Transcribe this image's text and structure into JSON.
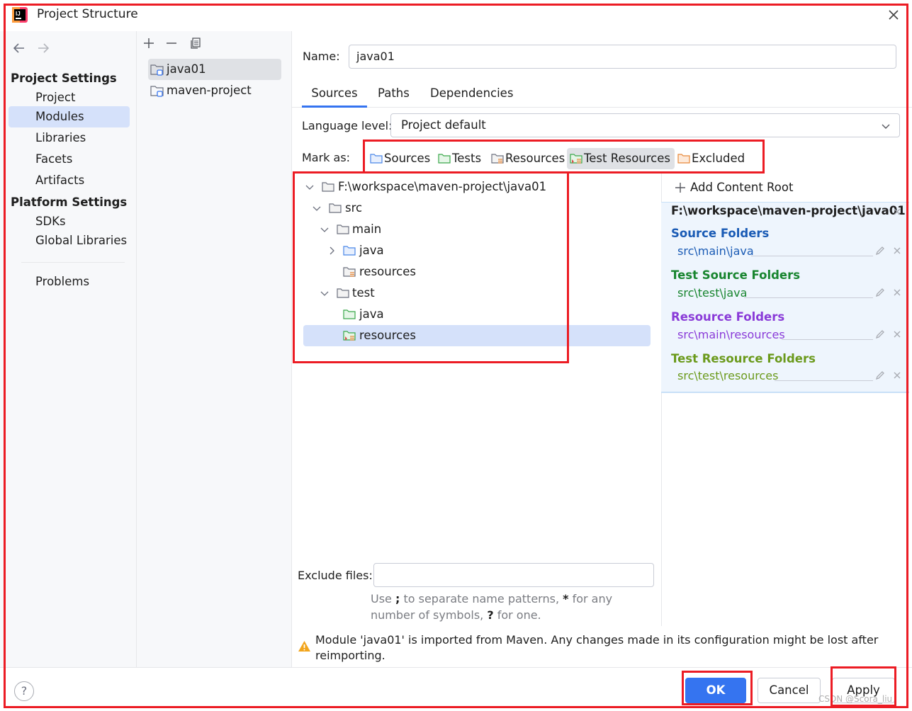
{
  "window": {
    "title": "Project Structure"
  },
  "nav": {
    "project_settings": "Project Settings",
    "project_items": [
      "Project",
      "Modules",
      "Libraries",
      "Facets",
      "Artifacts"
    ],
    "platform_settings": "Platform Settings",
    "platform_items": [
      "SDKs",
      "Global Libraries"
    ],
    "problems": "Problems",
    "selected": "Modules"
  },
  "modules": {
    "items": [
      "java01",
      "maven-project"
    ],
    "selected": "java01"
  },
  "module": {
    "name_label": "Name:",
    "name_value": "java01",
    "tabs": [
      "Sources",
      "Paths",
      "Dependencies"
    ],
    "active_tab": "Sources",
    "language_level_label": "Language level:",
    "language_level_value": "Project default",
    "mark_as_label": "Mark as:",
    "mark_buttons": [
      "Sources",
      "Tests",
      "Resources",
      "Test Resources",
      "Excluded"
    ],
    "pressed_mark": "Test Resources"
  },
  "tree": {
    "root": "F:\\workspace\\maven-project\\java01",
    "src": "src",
    "main": "main",
    "main_java": "java",
    "main_resources": "resources",
    "test": "test",
    "test_java": "java",
    "test_resources": "resources"
  },
  "content_root": {
    "add_label": "Add Content Root",
    "path": "F:\\workspace\\maven-project\\java01",
    "groups": [
      {
        "title": "Source Folders",
        "path": "src\\main\\java",
        "color": "#1a5bb5"
      },
      {
        "title": "Test Source Folders",
        "path": "src\\test\\java",
        "color": "#18852f"
      },
      {
        "title": "Resource Folders",
        "path": "src\\main\\resources",
        "color": "#8a3bd8"
      },
      {
        "title": "Test Resource Folders",
        "path": "src\\test\\resources",
        "color": "#6b9a1c"
      }
    ]
  },
  "exclude": {
    "label": "Exclude files:",
    "value": "",
    "hint_part1": "Use ",
    "hint_sep": ";",
    "hint_part2": " to separate name patterns, ",
    "hint_star": "*",
    "hint_part3": " for any number of symbols, ",
    "hint_q": "?",
    "hint_part4": " for one."
  },
  "warning": "Module 'java01' is imported from Maven. Any changes made in its configuration might be lost after reimporting.",
  "buttons": {
    "help": "?",
    "ok": "OK",
    "cancel": "Cancel",
    "apply": "Apply"
  },
  "watermark": "CSDN @Scora_liu",
  "colors": {
    "accent": "#3574f0",
    "selection": "#d5e1fa",
    "annotation_red": "#ec1c24",
    "folder_source": "#4a86e8",
    "folder_test": "#3aa84a",
    "folder_resource": "#e8893a"
  }
}
